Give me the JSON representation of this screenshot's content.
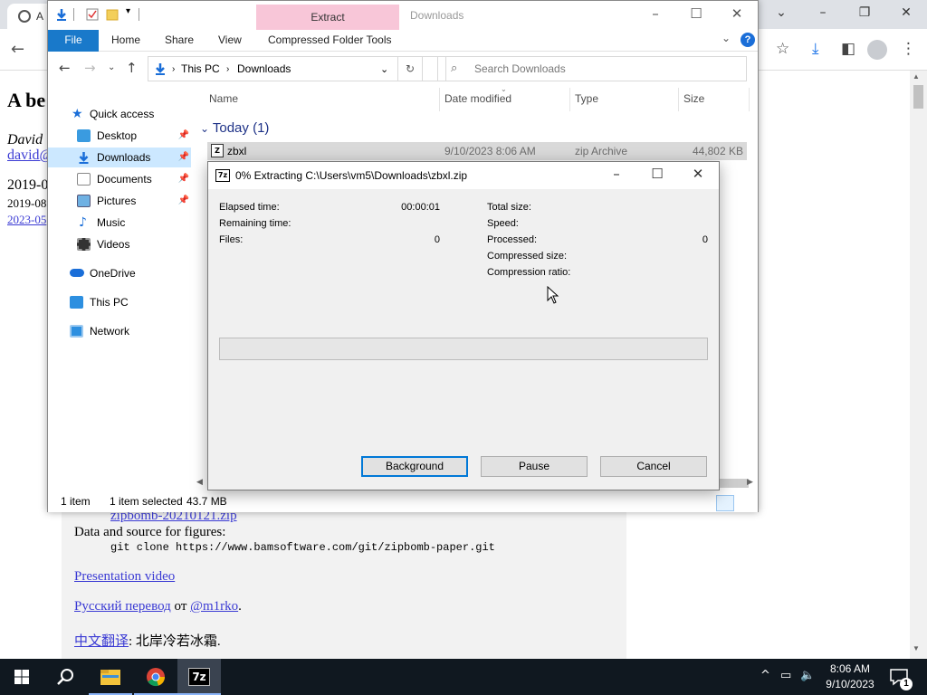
{
  "browser": {
    "tab_title": "A",
    "page": {
      "heading": "A be",
      "author": "David ",
      "email": "david@",
      "date1": "2019-0",
      "date2": "2019-08",
      "date3": "2023-05",
      "zip_link": "zipbomb-20210121.zip",
      "data_source": "Data and source for figures:",
      "git_cmd": "git clone https://www.bamsoftware.com/git/zipbomb-paper.git",
      "video_link": "Presentation video",
      "ru_link": "Русский перевод",
      "ru_sep": " от ",
      "ru_author": "@m1rko",
      "ru_end": ".",
      "cn_link": "中文翻译",
      "cn_rest": ": 北岸冷若冰霜."
    }
  },
  "explorer": {
    "extract_tab": "Extract",
    "title": "Downloads",
    "ribbon_tabs": [
      "File",
      "Home",
      "Share",
      "View",
      "Compressed Folder Tools"
    ],
    "address": [
      "This PC",
      "Downloads"
    ],
    "search_placeholder": "Search Downloads",
    "nav": {
      "quick_access": "Quick access",
      "desktop": "Desktop",
      "downloads": "Downloads",
      "documents": "Documents",
      "pictures": "Pictures",
      "music": "Music",
      "videos": "Videos",
      "onedrive": "OneDrive",
      "this_pc": "This PC",
      "network": "Network"
    },
    "columns": [
      "Name",
      "Date modified",
      "Type",
      "Size"
    ],
    "group": "Today (1)",
    "files": [
      {
        "name": "zbxl",
        "date": "9/10/2023 8:06 AM",
        "type": "zip Archive",
        "size": "44,802 KB"
      }
    ],
    "status": {
      "count": "1 item",
      "selected": "1 item selected",
      "selected_size": "43.7 MB"
    }
  },
  "dialog": {
    "title": "0% Extracting C:\\Users\\vm5\\Downloads\\zbxl.zip",
    "icon_text": "7z",
    "labels": {
      "elapsed": "Elapsed time:",
      "remaining": "Remaining time:",
      "files": "Files:",
      "total_size": "Total size:",
      "speed": "Speed:",
      "processed": "Processed:",
      "compressed_size": "Compressed size:",
      "ratio": "Compression ratio:"
    },
    "values": {
      "elapsed": "00:00:01",
      "files": "0",
      "processed": "0"
    },
    "progress": 0,
    "buttons": {
      "background": "Background",
      "pause": "Pause",
      "cancel": "Cancel"
    }
  },
  "taskbar": {
    "time": "8:06 AM",
    "date": "9/10/2023",
    "notification_count": "1"
  },
  "colors": {
    "explorer_accent": "#1979ca",
    "extract_tab": "#f8c6d8",
    "selected_nav": "#cce8ff",
    "taskbar": "#101820",
    "progress_fill": "#06b025",
    "link": "#3b3bd4"
  }
}
